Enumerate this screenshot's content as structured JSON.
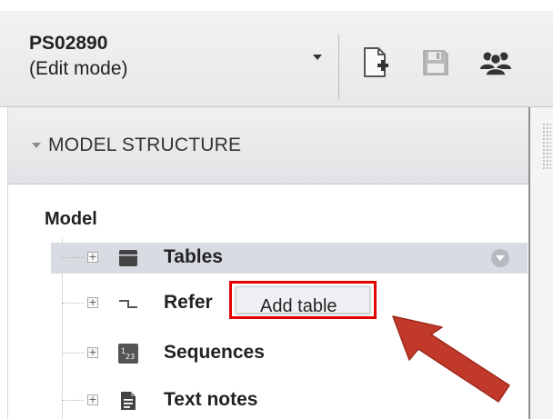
{
  "header": {
    "project_id": "PS02890",
    "project_mode": "(Edit mode)",
    "icons": [
      "chevron-down-icon",
      "new-document-icon",
      "save-icon",
      "users-icon"
    ]
  },
  "panel": {
    "title": "MODEL STRUCTURE",
    "root_label": "Model",
    "items": [
      {
        "label": "Tables",
        "icon": "table-icon",
        "selected": true
      },
      {
        "label": "Refer",
        "icon": "relation-icon",
        "selected": false
      },
      {
        "label": "Sequences",
        "icon": "sequence-icon",
        "selected": false
      },
      {
        "label": "Text notes",
        "icon": "text-note-icon",
        "selected": false
      }
    ]
  },
  "popup": {
    "label": "Add table",
    "highlight_color": "#e60000"
  },
  "annotation": {
    "arrow_color": "#c0392b"
  },
  "colors": {
    "selected_row": "#d8dbe1",
    "header_bg": "#ececec"
  }
}
